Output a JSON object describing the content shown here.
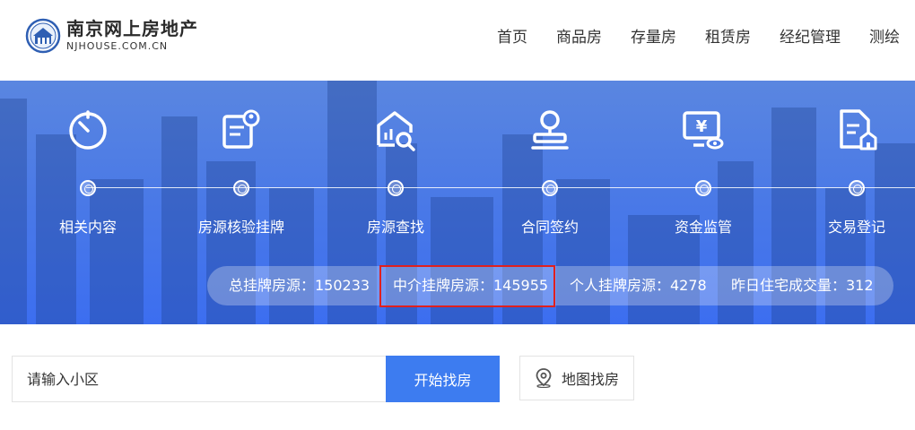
{
  "header": {
    "logo_cn": "南京网上房地产",
    "logo_en": "NJHOUSE.COM.CN",
    "nav": [
      "首页",
      "商品房",
      "存量房",
      "租赁房",
      "经纪管理",
      "测绘"
    ]
  },
  "banner": {
    "steps": [
      {
        "label": "相关内容",
        "icon": "timer-icon"
      },
      {
        "label": "房源核验挂牌",
        "icon": "listing-verify-icon"
      },
      {
        "label": "房源查找",
        "icon": "house-search-icon"
      },
      {
        "label": "合同签约",
        "icon": "seal-stamp-icon"
      },
      {
        "label": "资金监管",
        "icon": "fund-monitor-icon"
      },
      {
        "label": "交易登记",
        "icon": "registration-doc-icon"
      }
    ],
    "stats": [
      "总挂牌房源：150233",
      "中介挂牌房源：145955",
      "个人挂牌房源：4278",
      "昨日住宅成交量：312"
    ]
  },
  "search": {
    "placeholder": "请输入小区",
    "button": "开始找房",
    "map_button": "地图找房"
  },
  "colors": {
    "accent": "#3d7cf0",
    "highlight_border": "#e0201e"
  }
}
